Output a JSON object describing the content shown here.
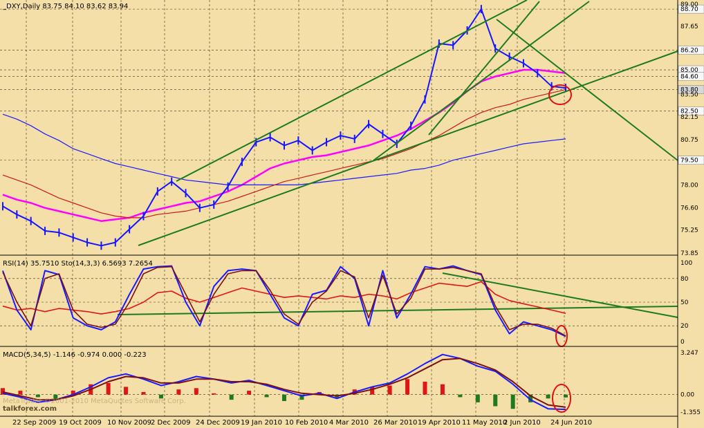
{
  "main": {
    "header": "_DXY,Daily  83.75 84.10 83.62 83.94",
    "price_labels": [
      "89.00",
      "88.70",
      "87.65",
      "86.20",
      "85.00",
      "84.60",
      "83.80",
      "83.50",
      "82.50",
      "82.15",
      "80.75",
      "79.50",
      "78.00",
      "76.60",
      "75.25",
      "73.85"
    ]
  },
  "rsi": {
    "header": "RSI(14) 35.7510  Sto(14,3,3) 6.5693 7.2654",
    "levels": [
      "100",
      "80",
      "50",
      "20",
      "0"
    ]
  },
  "macd": {
    "header": "MACD(5,34,5) -1.146 -0.974 0.000 -0.223",
    "levels": [
      "3.247",
      "0.00",
      "-1.355"
    ]
  },
  "x_labels": [
    "22 Sep 2009",
    "19 Oct 2009",
    "10 Nov 2009",
    "2 Dec 2009",
    "24 Dec 2009",
    "19 Jan 2010",
    "10 Feb 2010",
    "4 Mar 2010",
    "26 Mar 2010",
    "19 Apr 2010",
    "11 May 2010",
    "2 Jun 2010",
    "24 Jun 2010"
  ],
  "watermark": {
    "small": "MetaTrader  ©2001-2010 MetaQuotes Software Corp.",
    "logo": "talkforex.com"
  },
  "chart_data": {
    "type": "line",
    "title": "_DXY,Daily",
    "ohlc_last": {
      "open": 83.75,
      "high": 84.1,
      "low": 83.62,
      "close": 83.94
    },
    "x_dates": [
      "22 Sep 2009",
      "19 Oct 2009",
      "10 Nov 2009",
      "2 Dec 2009",
      "24 Dec 2009",
      "19 Jan 2010",
      "10 Feb 2010",
      "4 Mar 2010",
      "26 Mar 2010",
      "19 Apr 2010",
      "11 May 2010",
      "2 Jun 2010",
      "24 Jun 2010"
    ],
    "y_axis": {
      "min": 73.85,
      "max": 89.0
    },
    "series": [
      {
        "name": "price",
        "color": "#1515ff",
        "values": [
          76.7,
          76.2,
          75.8,
          75.2,
          75.1,
          74.8,
          74.5,
          74.3,
          74.5,
          75.3,
          76.1,
          77.6,
          78.2,
          77.5,
          76.6,
          76.8,
          77.9,
          79.4,
          80.6,
          80.9,
          80.4,
          80.7,
          80.1,
          80.6,
          81.0,
          80.8,
          81.7,
          81.1,
          80.5,
          81.6,
          83.2,
          86.6,
          86.5,
          87.4,
          88.7,
          86.3,
          85.8,
          85.4,
          84.8,
          84.0,
          83.9
        ]
      },
      {
        "name": "ma_magenta",
        "color": "#ff00ff",
        "values": [
          77.4,
          77.1,
          76.9,
          76.6,
          76.4,
          76.2,
          76.0,
          75.8,
          75.9,
          76.0,
          76.3,
          76.5,
          76.7,
          76.9,
          77.0,
          77.3,
          77.6,
          78.0,
          78.5,
          79.0,
          79.3,
          79.5,
          79.7,
          79.8,
          80.0,
          80.2,
          80.4,
          80.7,
          81.0,
          81.4,
          81.9,
          82.4,
          83.0,
          83.7,
          84.3,
          84.6,
          84.8,
          85.0,
          85.0,
          84.9,
          84.8
        ]
      },
      {
        "name": "ma_blue",
        "color": "#1a1aff",
        "values": [
          82.3,
          82.0,
          81.6,
          81.1,
          80.7,
          80.2,
          79.9,
          79.6,
          79.3,
          79.1,
          78.9,
          78.7,
          78.5,
          78.3,
          78.2,
          78.1,
          78.0,
          78.0,
          78.0,
          78.0,
          78.0,
          78.0,
          78.1,
          78.2,
          78.3,
          78.4,
          78.5,
          78.6,
          78.7,
          78.9,
          79.0,
          79.2,
          79.5,
          79.7,
          79.9,
          80.1,
          80.3,
          80.5,
          80.6,
          80.7,
          80.8
        ]
      },
      {
        "name": "ma_red",
        "color": "#cc1a1a",
        "values": [
          78.6,
          78.3,
          78.0,
          77.6,
          77.2,
          76.9,
          76.6,
          76.3,
          76.1,
          76.0,
          76.0,
          76.2,
          76.3,
          76.4,
          76.6,
          76.8,
          77.0,
          77.3,
          77.6,
          77.9,
          78.2,
          78.4,
          78.6,
          78.8,
          79.0,
          79.2,
          79.4,
          79.6,
          79.9,
          80.2,
          80.6,
          81.0,
          81.5,
          82.0,
          82.4,
          82.7,
          82.9,
          83.2,
          83.4,
          83.6,
          83.8
        ]
      }
    ],
    "rsi_series": [
      {
        "name": "RSI",
        "color": "#e21515",
        "ylim": [
          0,
          100
        ],
        "values": [
          45,
          40,
          42,
          38,
          42,
          40,
          38,
          35,
          38,
          42,
          50,
          62,
          64,
          55,
          50,
          56,
          62,
          68,
          64,
          60,
          56,
          58,
          56,
          54,
          58,
          56,
          60,
          58,
          54,
          62,
          68,
          74,
          72,
          70,
          76,
          60,
          52,
          48,
          44,
          40,
          35.8
        ]
      },
      {
        "name": "Sto %K",
        "color": "#1a1aff",
        "ylim": [
          0,
          100
        ],
        "values": [
          90,
          40,
          15,
          90,
          85,
          30,
          20,
          15,
          25,
          60,
          92,
          95,
          96,
          50,
          20,
          70,
          90,
          92,
          90,
          60,
          30,
          20,
          60,
          65,
          95,
          80,
          20,
          90,
          30,
          60,
          95,
          92,
          96,
          90,
          85,
          40,
          10,
          25,
          20,
          15,
          6.6
        ]
      },
      {
        "name": "Sto %D",
        "color": "#7a1010",
        "ylim": [
          0,
          100
        ],
        "values": [
          88,
          50,
          20,
          80,
          86,
          40,
          22,
          18,
          22,
          50,
          86,
          94,
          95,
          60,
          25,
          60,
          86,
          90,
          90,
          65,
          35,
          22,
          50,
          64,
          90,
          82,
          30,
          84,
          35,
          55,
          92,
          92,
          94,
          90,
          86,
          45,
          15,
          22,
          22,
          17,
          7.3
        ]
      }
    ],
    "macd_series": [
      {
        "name": "MACD",
        "color": "#1a1aff",
        "values": [
          0.1,
          -0.2,
          -0.6,
          -0.4,
          0.0,
          0.6,
          1.3,
          1.6,
          1.2,
          0.7,
          1.0,
          1.4,
          1.2,
          0.9,
          1.1,
          0.7,
          0.3,
          -0.1,
          0.1,
          -0.3,
          0.2,
          0.6,
          0.9,
          1.6,
          2.4,
          3.1,
          2.8,
          2.2,
          1.8,
          0.8,
          -0.4,
          -1.1,
          -1.146
        ]
      },
      {
        "name": "Signal",
        "color": "#7a1010",
        "values": [
          0.2,
          -0.1,
          -0.4,
          -0.4,
          -0.1,
          0.4,
          1.0,
          1.4,
          1.3,
          0.9,
          0.9,
          1.2,
          1.2,
          1.0,
          1.0,
          0.8,
          0.4,
          0.1,
          0.0,
          -0.1,
          0.1,
          0.4,
          0.8,
          1.3,
          2.0,
          2.7,
          2.8,
          2.4,
          1.9,
          1.0,
          -0.1,
          -0.8,
          -0.974
        ]
      },
      {
        "name": "Histogram",
        "values": [
          0.5,
          0.3,
          -0.2,
          -0.4,
          0.3,
          0.8,
          0.9,
          0.6,
          0.2,
          -0.3,
          0.4,
          0.5,
          0.1,
          -0.4,
          0.3,
          -0.2,
          -0.5,
          -0.4,
          0.2,
          -0.3,
          0.4,
          0.6,
          0.7,
          1.2,
          1.0,
          0.8,
          -0.2,
          -0.6,
          -0.9,
          -1.1,
          -0.6,
          -0.3,
          -0.223
        ]
      }
    ],
    "macd_ylim": [
      -1.355,
      3.247
    ]
  }
}
